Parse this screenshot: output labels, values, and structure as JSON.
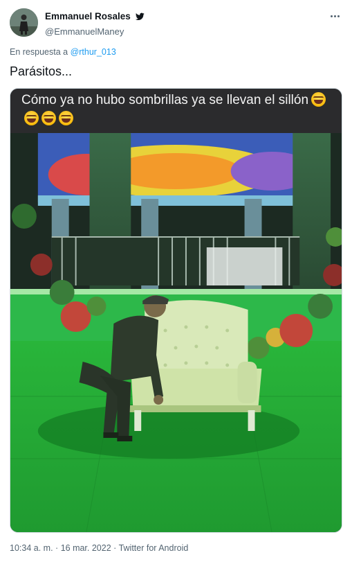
{
  "author": {
    "display_name": "Emmanuel Rosales",
    "handle": "@EmmanuelManey",
    "verified_icon": "twitter-bird-icon"
  },
  "reply": {
    "prefix": "En respuesta a",
    "to": "@rthur_013"
  },
  "tweet": {
    "text": "Parásitos..."
  },
  "media": {
    "caption_text": "Cómo ya no hubo sombrillas ya se llevan el sillón",
    "caption_emoji": [
      "face-with-tears-of-joy-icon",
      "face-with-tears-of-joy-icon",
      "face-with-tears-of-joy-icon",
      "face-with-tears-of-joy-icon"
    ]
  },
  "meta": {
    "time": "10:34 a. m.",
    "date": "16 mar. 2022",
    "source": "Twitter for Android",
    "separator": "·"
  },
  "colors": {
    "link": "#1d9bf0",
    "secondary_text": "#536471",
    "photo_tint": "#2fbf3a"
  }
}
